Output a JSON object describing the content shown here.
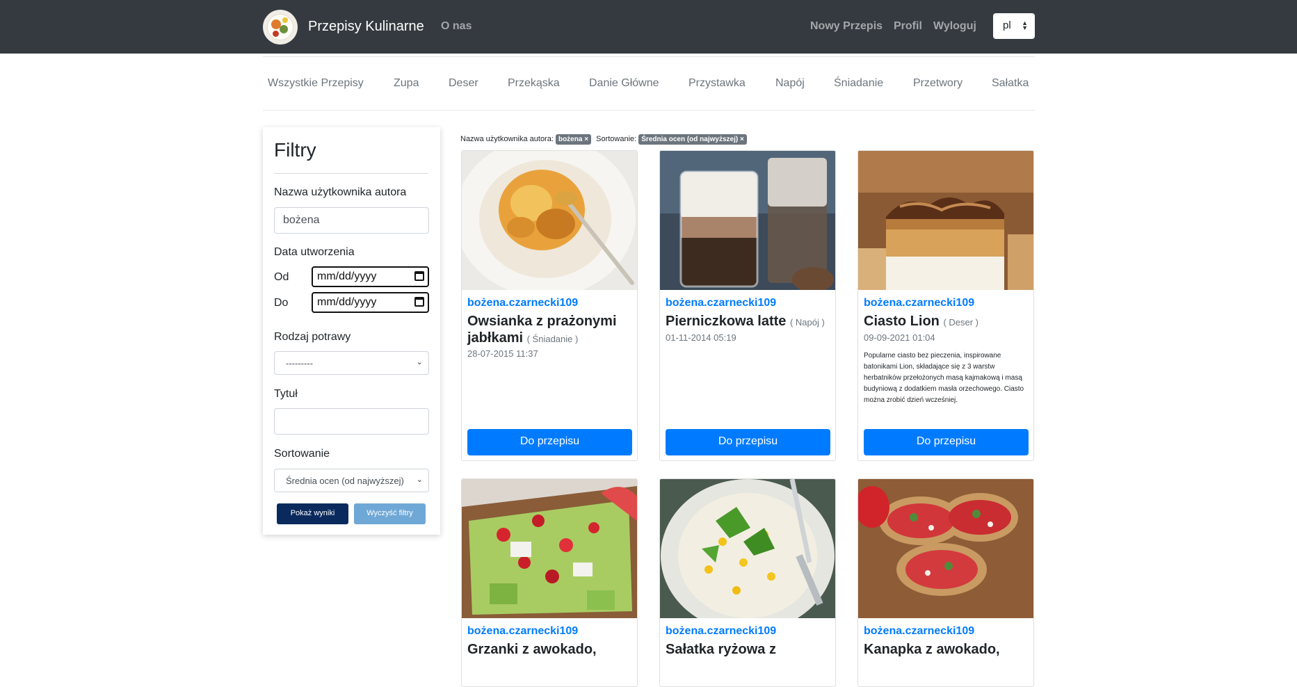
{
  "navbar": {
    "brand": "Przepisy Kulinarne",
    "about": "O nas",
    "new_recipe": "Nowy Przepis",
    "profile": "Profil",
    "logout": "Wyloguj",
    "language": "pl",
    "bg_color": "#343a40"
  },
  "categories": [
    "Wszystkie Przepisy",
    "Zupa",
    "Deser",
    "Przekąska",
    "Danie Główne",
    "Przystawka",
    "Napój",
    "Śniadanie",
    "Przetwory",
    "Sałatka"
  ],
  "filters": {
    "title": "Filtry",
    "author_label": "Nazwa użytkownika autora",
    "author_value": "bożena",
    "date_label": "Data utworzenia",
    "from_label": "Od",
    "from_placeholder": "mm/dd/yyyy",
    "to_label": "Do",
    "to_placeholder": "mm/dd/yyyy",
    "dish_type_label": "Rodzaj potrawy",
    "dish_type_value": "---------",
    "title_label": "Tytuł",
    "title_value": "",
    "sort_label": "Sortowanie",
    "sort_value": "Średnia ocen (od najwyższej)",
    "show_button": "Pokaż wyniki",
    "clear_button": "Wyczyść filtry"
  },
  "active_filters": {
    "author_label": "Nazwa użytkownika autora:",
    "author_badge": "bożena ×",
    "sort_label": "Sortowanie:",
    "sort_badge": "Średnia ocen (od najwyższej) ×"
  },
  "recipes": [
    {
      "author": "bożena.czarnecki109",
      "title": "Owsianka z prażonymi jabłkami",
      "category": "( Śniadanie )",
      "date": "28-07-2015 11:37",
      "description": "",
      "button": "Do przepisu",
      "image_icon": "oatmeal-image"
    },
    {
      "author": "bożena.czarnecki109",
      "title": "Pierniczkowa latte",
      "category": "( Napój )",
      "date": "01-11-2014 05:19",
      "description": "",
      "button": "Do przepisu",
      "image_icon": "latte-image"
    },
    {
      "author": "bożena.czarnecki109",
      "title": "Ciasto Lion",
      "category": "( Deser )",
      "date": "09-09-2021 01:04",
      "description": "Popularne ciasto bez pieczenia, inspirowane batonikami Lion, składające się z 3 warstw herbatników przełożonych masą kajmakową i masą budyniową z dodatkiem masła orzechowego. Ciasto można zrobić dzień wcześniej.",
      "button": "Do przepisu",
      "image_icon": "cake-image"
    },
    {
      "author": "bożena.czarnecki109",
      "title": "Grzanki z awokado,",
      "image_icon": "avocado-toast-image"
    },
    {
      "author": "bożena.czarnecki109",
      "title": "Sałatka ryżowa z",
      "image_icon": "rice-salad-image"
    },
    {
      "author": "bożena.czarnecki109",
      "title": "Kanapka z awokado,",
      "image_icon": "sandwich-image"
    }
  ],
  "colors": {
    "primary": "#007bff",
    "dark_button": "#0a2a5e",
    "light_button": "#6fa8d6",
    "badge": "#6c757d"
  }
}
